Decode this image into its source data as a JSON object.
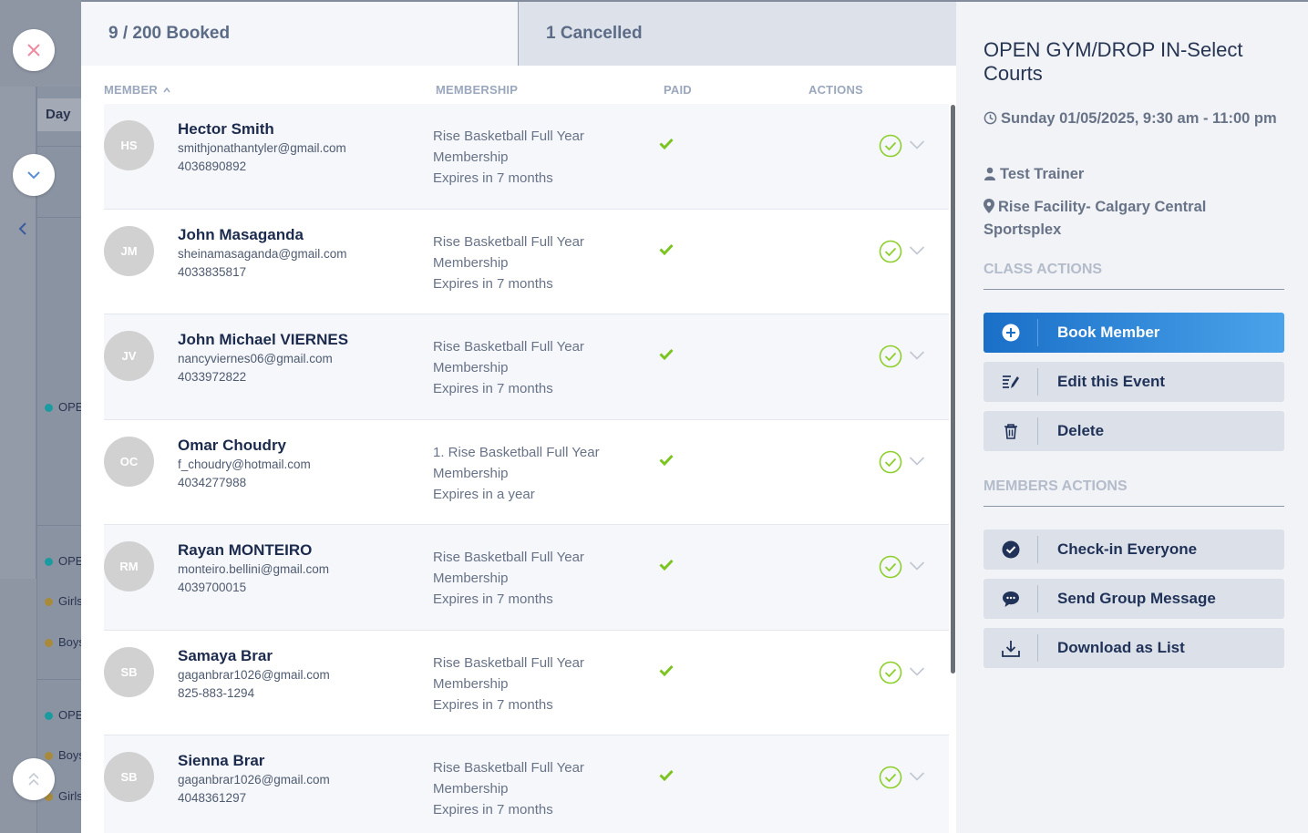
{
  "background": {
    "view_label": "Day",
    "events": [
      {
        "label": "OPE",
        "color": "#1b9aa0"
      },
      {
        "label": "OPE",
        "color": "#1b9aa0"
      },
      {
        "label": "Girls",
        "color": "#a88a3a"
      },
      {
        "label": "Boys",
        "color": "#a88a3a"
      },
      {
        "label": "OPE",
        "color": "#1b9aa0"
      },
      {
        "label": "Boys",
        "color": "#a88a3a"
      },
      {
        "label": "Girls",
        "color": "#a88a3a"
      }
    ]
  },
  "tabs": {
    "booked": "9 / 200 Booked",
    "cancelled": "1 Cancelled"
  },
  "table": {
    "headers": {
      "member": "MEMBER",
      "membership": "MEMBERSHIP",
      "paid": "PAID",
      "actions": "ACTIONS"
    },
    "rows": [
      {
        "initials": "HS",
        "name": "Hector Smith",
        "email": "smithjonathantyler@gmail.com",
        "phone": "4036890892",
        "membership_line1": "Rise Basketball Full Year",
        "membership_line2": "Membership",
        "expires": "Expires in 7 months"
      },
      {
        "initials": "JM",
        "name": "John Masaganda",
        "email": "sheinamasaganda@gmail.com",
        "phone": "4033835817",
        "membership_line1": "Rise Basketball Full Year",
        "membership_line2": "Membership",
        "expires": "Expires in 7 months"
      },
      {
        "initials": "JV",
        "name": "John Michael VIERNES",
        "email": "nancyviernes06@gmail.com",
        "phone": "4033972822",
        "membership_line1": "Rise Basketball Full Year",
        "membership_line2": "Membership",
        "expires": "Expires in 7 months"
      },
      {
        "initials": "OC",
        "name": "Omar Choudry",
        "email": "f_choudry@hotmail.com",
        "phone": "4034277988",
        "membership_line1": "1. Rise Basketball Full Year",
        "membership_line2": "Membership",
        "expires": "Expires in a year"
      },
      {
        "initials": "RM",
        "name": "Rayan MONTEIRO",
        "email": "monteiro.bellini@gmail.com",
        "phone": "4039700015",
        "membership_line1": "Rise Basketball Full Year",
        "membership_line2": "Membership",
        "expires": "Expires in 7 months"
      },
      {
        "initials": "SB",
        "name": "Samaya Brar",
        "email": "gaganbrar1026@gmail.com",
        "phone": "825-883-1294",
        "membership_line1": "Rise Basketball Full Year",
        "membership_line2": "Membership",
        "expires": "Expires in 7 months"
      },
      {
        "initials": "SB",
        "name": "Sienna Brar",
        "email": "gaganbrar1026@gmail.com",
        "phone": "4048361297",
        "membership_line1": "Rise Basketball Full Year",
        "membership_line2": "Membership",
        "expires": "Expires in 7 months"
      }
    ]
  },
  "panel": {
    "title": "OPEN GYM/DROP IN-Select Courts",
    "datetime": "Sunday 01/05/2025, 9:30 am - 11:00 pm",
    "trainer": "Test Trainer",
    "location": "Rise Facility- Calgary Central Sportsplex",
    "class_actions_heading": "CLASS ACTIONS",
    "book_member": "Book Member",
    "edit_event": "Edit this Event",
    "delete": "Delete",
    "members_actions_heading": "MEMBERS ACTIONS",
    "checkin_everyone": "Check-in Everyone",
    "send_group_message": "Send Group Message",
    "download_list": "Download as List"
  },
  "colors": {
    "paid_check": "#7cc422",
    "checkin_ring": "#8ccf2a",
    "primary_button_start": "#1a6fc7",
    "primary_button_end": "#4aa3ea",
    "close_icon": "#f08aa0"
  },
  "icons": {
    "close": "close-icon",
    "collapse": "chevron-down-icon",
    "scroll_top": "double-chevron-up-icon",
    "back": "chevron-left-icon",
    "sort": "sort-up-icon",
    "paid": "check-icon",
    "checkin": "check-circle-icon",
    "expand_row": "chevron-down-icon",
    "clock": "clock-icon",
    "user": "user-icon",
    "location": "map-pin-icon",
    "book": "plus-circle-icon",
    "edit": "edit-icon",
    "delete": "trash-icon",
    "checkin_all": "check-circle-filled-icon",
    "message": "chat-bubble-icon",
    "download": "download-icon"
  }
}
